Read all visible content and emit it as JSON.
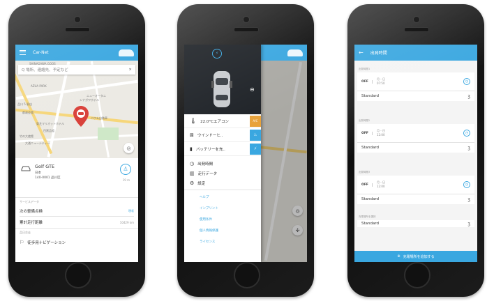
{
  "phone1": {
    "app_title": "Car-Net",
    "search_placeholder": "Q 場所、連絡先、予定など",
    "map_labels": [
      "SHINAGAWA GOOS",
      "AZUA PARK",
      "ニューオータニ",
      "シナガワホテル",
      "品川 5 駅店",
      "都政会館",
      "東芝マリオットホテル",
      "目黒品組",
      "ハワム自動車",
      "竹の大使館",
      "大通ニューシティー"
    ],
    "car_model": "Golf GTE",
    "car_country": "日本",
    "car_address": "140-0001 品川区",
    "distance": "19 m",
    "section_service": "サービスデータ",
    "next_service_label": "次の整備点検",
    "next_service_value": "現状",
    "odometer_label": "累計走行距離",
    "odometer_value": "10429 km",
    "section_other": "品日交走",
    "footer_label": "徒歩用ナビゲーション"
  },
  "phone2": {
    "header_icons": [
      "ev-charge-icon",
      "car-icon"
    ],
    "items": [
      {
        "icon": "thermometer-icon",
        "label": "22.0°Cエアコン",
        "btn": "A/C",
        "btn_color": "#e8a23a"
      },
      {
        "icon": "windshield-icon",
        "label": "ウインドーヒ..",
        "btn": "♨",
        "btn_color": "#3aa7e0"
      },
      {
        "icon": "battery-icon",
        "label": "バッテリーを充..",
        "btn": "⚡",
        "btn_color": "#3aa7e0"
      }
    ],
    "menu": [
      "出発時間",
      "走行データ",
      "設定"
    ],
    "links": [
      "ヘルプ",
      "インプリント",
      "使用条件",
      "個人情報保護",
      "ライセンス"
    ]
  },
  "phone3": {
    "title": "出発時間",
    "sections": [
      {
        "label": "出発時間1",
        "toggle": "OFF",
        "days": "月 - 日",
        "time": "07:50",
        "mode": "Standard"
      },
      {
        "label": "出発時間2",
        "toggle": "OFF",
        "days": "月 - 日",
        "time": "12:00",
        "mode": "Standard"
      },
      {
        "label": "出発時間3",
        "toggle": "OFF",
        "days": "月 - 日",
        "time": "12:00",
        "mode": "Standard"
      }
    ],
    "last_section_label": "充電場所を選択",
    "last_mode": "Standard",
    "add_button": "充電場所を追加する"
  }
}
